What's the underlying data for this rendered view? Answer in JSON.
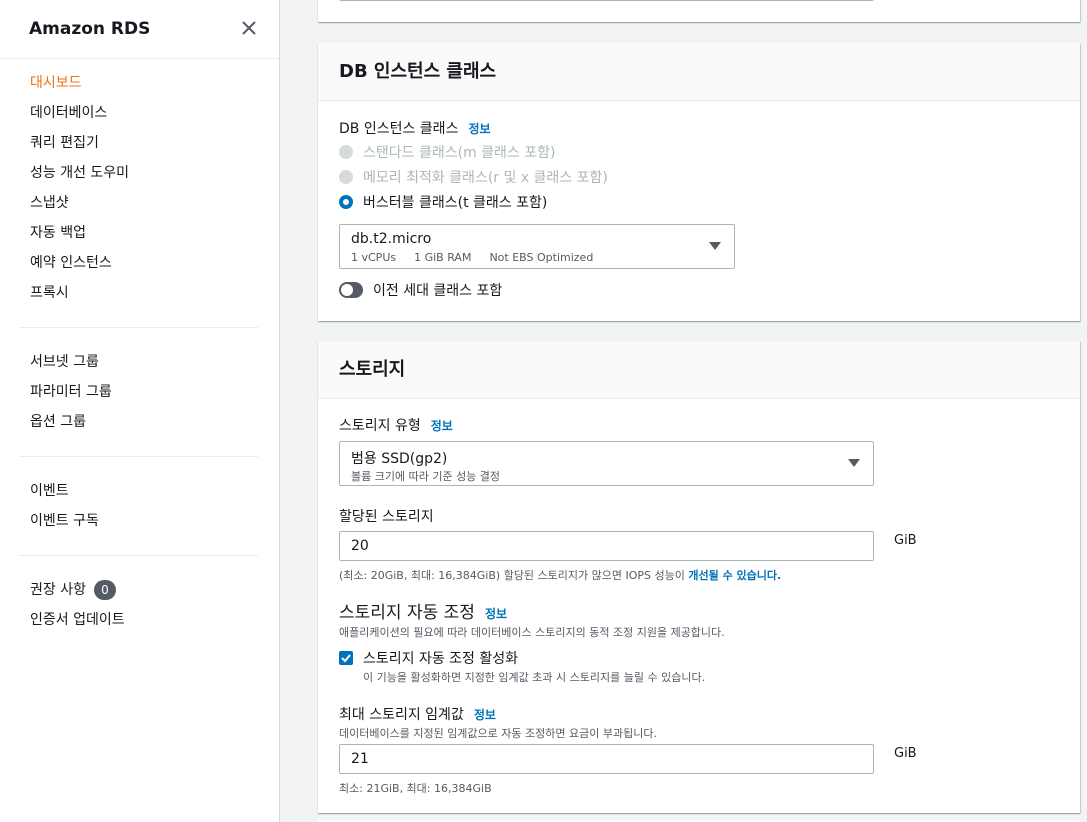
{
  "sidebar": {
    "title": "Amazon RDS",
    "groups": [
      [
        "대시보드",
        "데이터베이스",
        "쿼리 편집기",
        "성능 개선 도우미",
        "스냅샷",
        "자동 백업",
        "예약 인스턴스",
        "프록시"
      ],
      [
        "서브넷 그룹",
        "파라미터 그룹",
        "옵션 그룹"
      ],
      [
        "이벤트",
        "이벤트 구독"
      ],
      [
        "권장 사항",
        "인증서 업데이트"
      ]
    ],
    "recommendations_count": "0"
  },
  "instance_class": {
    "title": "DB 인스턴스 클래스",
    "field_label": "DB 인스턴스 클래스",
    "info": "정보",
    "options": [
      "스탠다드 클래스(m 클래스 포함)",
      "메모리 최적화 클래스(r 및 x 클래스 포함)",
      "버스터블 클래스(t 클래스 포함)"
    ],
    "selected": "db.t2.micro",
    "specs": [
      "1 vCPUs",
      "1 GiB RAM",
      "Not EBS Optimized"
    ],
    "toggle_label": "이전 세대 클래스 포함"
  },
  "storage": {
    "title": "스토리지",
    "type_label": "스토리지 유형",
    "info": "정보",
    "type_value": "범용 SSD(gp2)",
    "type_desc": "볼륨 크기에 따라 기준 성능 결정",
    "allocated_label": "할당된 스토리지",
    "allocated_value": "20",
    "unit": "GiB",
    "allocated_hint": "(최소: 20GiB, 최대: 16,384GiB) 할당된 스토리지가 많으면 IOPS 성능이 ",
    "allocated_hint_link": "개선될 수 있습니다.",
    "autoscale_title": "스토리지 자동 조정",
    "autoscale_desc": "애플리케이션의 필요에 따라 데이터베이스 스토리지의 동적 조정 지원을 제공합니다.",
    "autoscale_check_label": "스토리지 자동 조정 활성화",
    "autoscale_check_desc": "이 기능을 활성화하면 지정한 임계값 초과 시 스토리지를 늘릴 수 있습니다.",
    "max_label": "최대 스토리지 임계값",
    "max_desc": "데이터베이스를 지정된 임계값으로 자동 조정하면 요금이 부과됩니다.",
    "max_value": "21",
    "max_hint": "최소: 21GiB, 최대: 16,384GiB"
  }
}
